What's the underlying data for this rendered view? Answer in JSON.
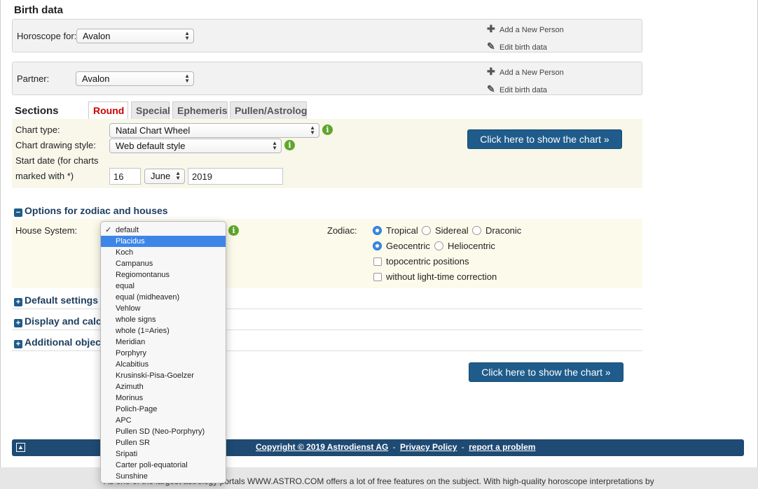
{
  "birth": {
    "title": "Birth data",
    "horoscope_label": "Horoscope for:",
    "horoscope_value": "Avalon",
    "partner_label": "Partner:",
    "partner_value": "Avalon",
    "add_person": "Add a New Person",
    "edit_birth": "Edit birth data"
  },
  "sections": {
    "title": "Sections",
    "tabs": [
      "Round",
      "Special",
      "Ephemeris",
      "Pullen/Astrolog"
    ],
    "chart_type_label": "Chart type:",
    "chart_type_value": "Natal Chart Wheel",
    "drawing_style_label": "Chart drawing style:",
    "drawing_style_value": "Web default style",
    "start_date_label_1": "Start date (for charts",
    "start_date_label_2": "marked with *)",
    "day": "16",
    "month": "June",
    "year": "2019",
    "show_chart_button": "Click here to show the chart »"
  },
  "options": {
    "heading": "Options for zodiac and houses",
    "house_system_label": "House System:",
    "zodiac_label": "Zodiac:",
    "zodiac_options": [
      "Tropical",
      "Sidereal",
      "Draconic"
    ],
    "zodiac_selected": "Tropical",
    "centric_options": [
      "Geocentric",
      "Heliocentric"
    ],
    "centric_selected": "Geocentric",
    "topocentric": "topocentric positions",
    "lighttime": "without light-time correction"
  },
  "collapsed": {
    "default_settings": "Default settings",
    "display_calc": "Display and calc",
    "additional_objects": "Additional objec"
  },
  "bottom_button": "Click here to show the chart »",
  "footer": {
    "copyright": "Copyright © 2019 Astrodienst AG",
    "privacy": "Privacy Policy",
    "report": "report a problem",
    "sep": "-",
    "tagline": "As one of the largest astrology portals WWW.ASTRO.COM offers a lot of free features on the subject. With high-quality horoscope interpretations by"
  },
  "house_dropdown": {
    "checked": "default",
    "highlighted": "Placidus",
    "items": [
      "default",
      "Placidus",
      "Koch",
      "Campanus",
      "Regiomontanus",
      "equal",
      "equal (midheaven)",
      "Vehlow",
      "whole signs",
      "whole (1=Aries)",
      "Meridian",
      "Porphyry",
      "Alcabitius",
      "Krusinski-Pisa-Goelzer",
      "Azimuth",
      "Morinus",
      "Polich-Page",
      "APC",
      "Pullen SD (Neo-Porphyry)",
      "Pullen SR",
      "Sripati",
      "Carter poli-equatorial",
      "Sunshine"
    ]
  },
  "colors": {
    "accent": "#1f5c8b",
    "active_tab": "#cc0000",
    "info": "#5ea62c",
    "highlight": "#3d86e8"
  }
}
